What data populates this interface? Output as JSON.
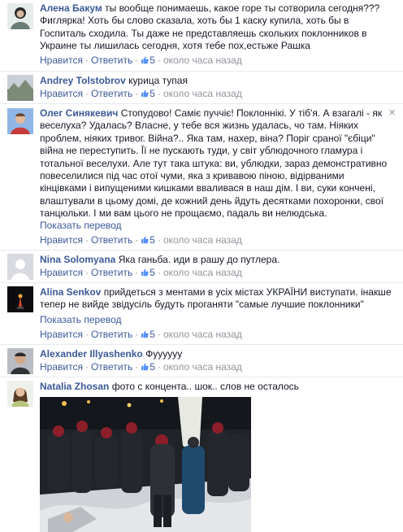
{
  "action_labels": {
    "like": "Нравится",
    "reply": "Ответить",
    "time": "около часа назад",
    "show_translation": "Показать перевод",
    "dot": "·"
  },
  "comments": [
    {
      "author": "Алена Бакум",
      "text": "ты вообще понимаешь, какое горе ты сотворила сегодня??? Фиглярка! Хоть бы слово сказала, хоть бы 1 каску купила, хоть бы в Госпиталь сходила. Ты даже не представляешь скольких поклонников в Украине ты лишилась сегодня, хотя тебе пох,естьже Рашка",
      "likes": "5"
    },
    {
      "author": "Andrey Tolstobrov",
      "text": "курица тупая",
      "likes": "5"
    },
    {
      "author": "Олег Синякевич",
      "text": "Стопудово! Самiє пуччiє! Поклоннiкi. У тiб'я. А взагалi - як веселуха? Удалась? Власне, у тебе вся жизнь удалась, чо там. Нiяких проблем, нiяких тривог. Війна?.. Яка там, нахер, віна? Поріг сраної \"єбіци\" війна не переступить. Її не пускають туди, у світ ублюдочного гламура і тотальної веселухи. Але тут така штука: ви, ублюдки, зараз демонстративно повеселилися під час отої чуми, яка з кривавою піною, відірваними кінцівками і випущеними кишками вваливася в наш дім. І ви, суки кончені, влаштували в цьому домі, де кожний день йдуть десятками похоронки, свої танцюльки. І ми вам цього не прощаємо, падаль ви нелюдська.",
      "likes": "5",
      "show_translation": true
    },
    {
      "author": "Nina Solomyana",
      "text": "Яка ганьба. иди в рашу до путлера.",
      "likes": "5"
    },
    {
      "author": "Alina Senkov",
      "text": "прийдеться з ментами в усіх містах УКРАЇНИ виступати. інакше тепер не вийде звідусіль будуть проганяти \"самые лучшие поклонники\"",
      "likes": "5",
      "show_translation": true
    },
    {
      "author": "Alexander Illyashenko",
      "text": "Фуууууу",
      "likes": "5"
    },
    {
      "author": "Natalia Zhosan",
      "text": "фото с концента.. шок.. слов не осталось",
      "likes": ""
    }
  ],
  "colors": {
    "link": "#3b5998",
    "text": "#141823",
    "muted": "#90949c",
    "divider": "#e9eaed"
  },
  "icons": {
    "like": "thumbs-up-icon",
    "close": "close-icon"
  }
}
